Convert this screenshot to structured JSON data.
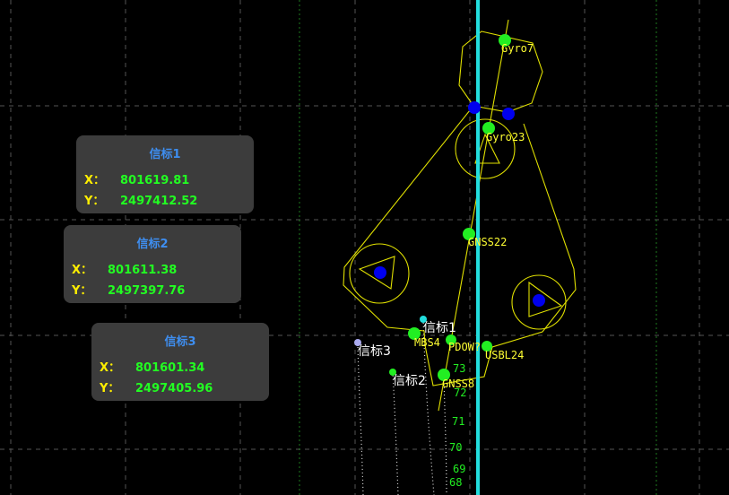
{
  "beacons": [
    {
      "title": "信标1",
      "x_label": "X：",
      "x_value": "801619.81",
      "y_label": "Y：",
      "y_value": "2497412.52"
    },
    {
      "title": "信标2",
      "x_label": "X：",
      "x_value": "801611.38",
      "y_label": "Y：",
      "y_value": "2497397.76"
    },
    {
      "title": "信标3",
      "x_label": "X：",
      "x_value": "801601.34",
      "y_label": "Y：",
      "y_value": "2497405.96"
    }
  ],
  "sensors": {
    "gyro7": "Gyro7",
    "gyro23": "Gyro23",
    "gnss22": "GNSS22",
    "mbs4": "MBS4",
    "pdow": "PDOW?",
    "usbl24": "USBL24",
    "gnss8": "GNSS8"
  },
  "map_beacons": {
    "b1": "信标1",
    "b2": "信标2",
    "b3": "信标3"
  },
  "track_numbers": [
    "73",
    "72",
    "71",
    "70",
    "69",
    "68"
  ],
  "colors": {
    "background": "#000000",
    "grid": "#555555",
    "hull_outline": "#e0e000",
    "sensor_point": "#22ee22",
    "thruster_point": "#0000ee",
    "center_line": "#22dddd",
    "card_bg": "#3c3c3c",
    "card_title": "#3e8ef0",
    "card_key": "#ffee00",
    "card_value": "#22ff22"
  }
}
